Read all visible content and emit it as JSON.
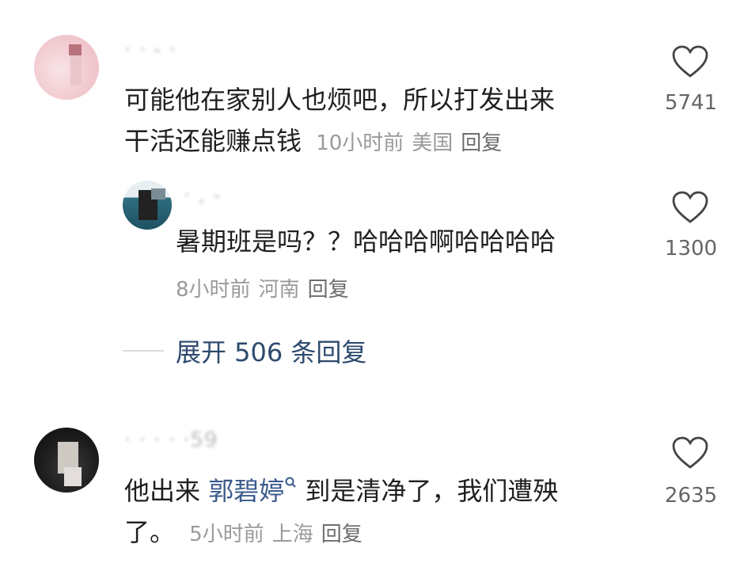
{
  "comments": [
    {
      "username": "·  · - ·",
      "text_line1": "可能他在家别人也烦吧，所以打发出来",
      "text_line2": "干活还能赚点钱",
      "time": "10小时前",
      "location": "美国",
      "reply_label": "回复",
      "likes": "5741"
    },
    {
      "username": "· , -",
      "text": "暑期班是吗？？哈哈哈啊哈哈哈哈",
      "time": "8小时前",
      "location": "河南",
      "reply_label": "回复",
      "likes": "1300"
    },
    {
      "username": "· · · · ·59",
      "text_pre": "他出来",
      "mention": "郭碧婷",
      "text_post": "到是清净了，我们遭殃",
      "text_line2": "了。",
      "time": "5小时前",
      "location": "上海",
      "reply_label": "回复",
      "likes": "2635"
    }
  ],
  "expand_replies": "展开 506 条回复",
  "icons": {
    "like": "heart-outline-icon",
    "search": "search-mini-icon"
  },
  "colors": {
    "mention": "#3a5a8c",
    "expand": "#2d4a6e",
    "meta": "#9a9a9a"
  }
}
